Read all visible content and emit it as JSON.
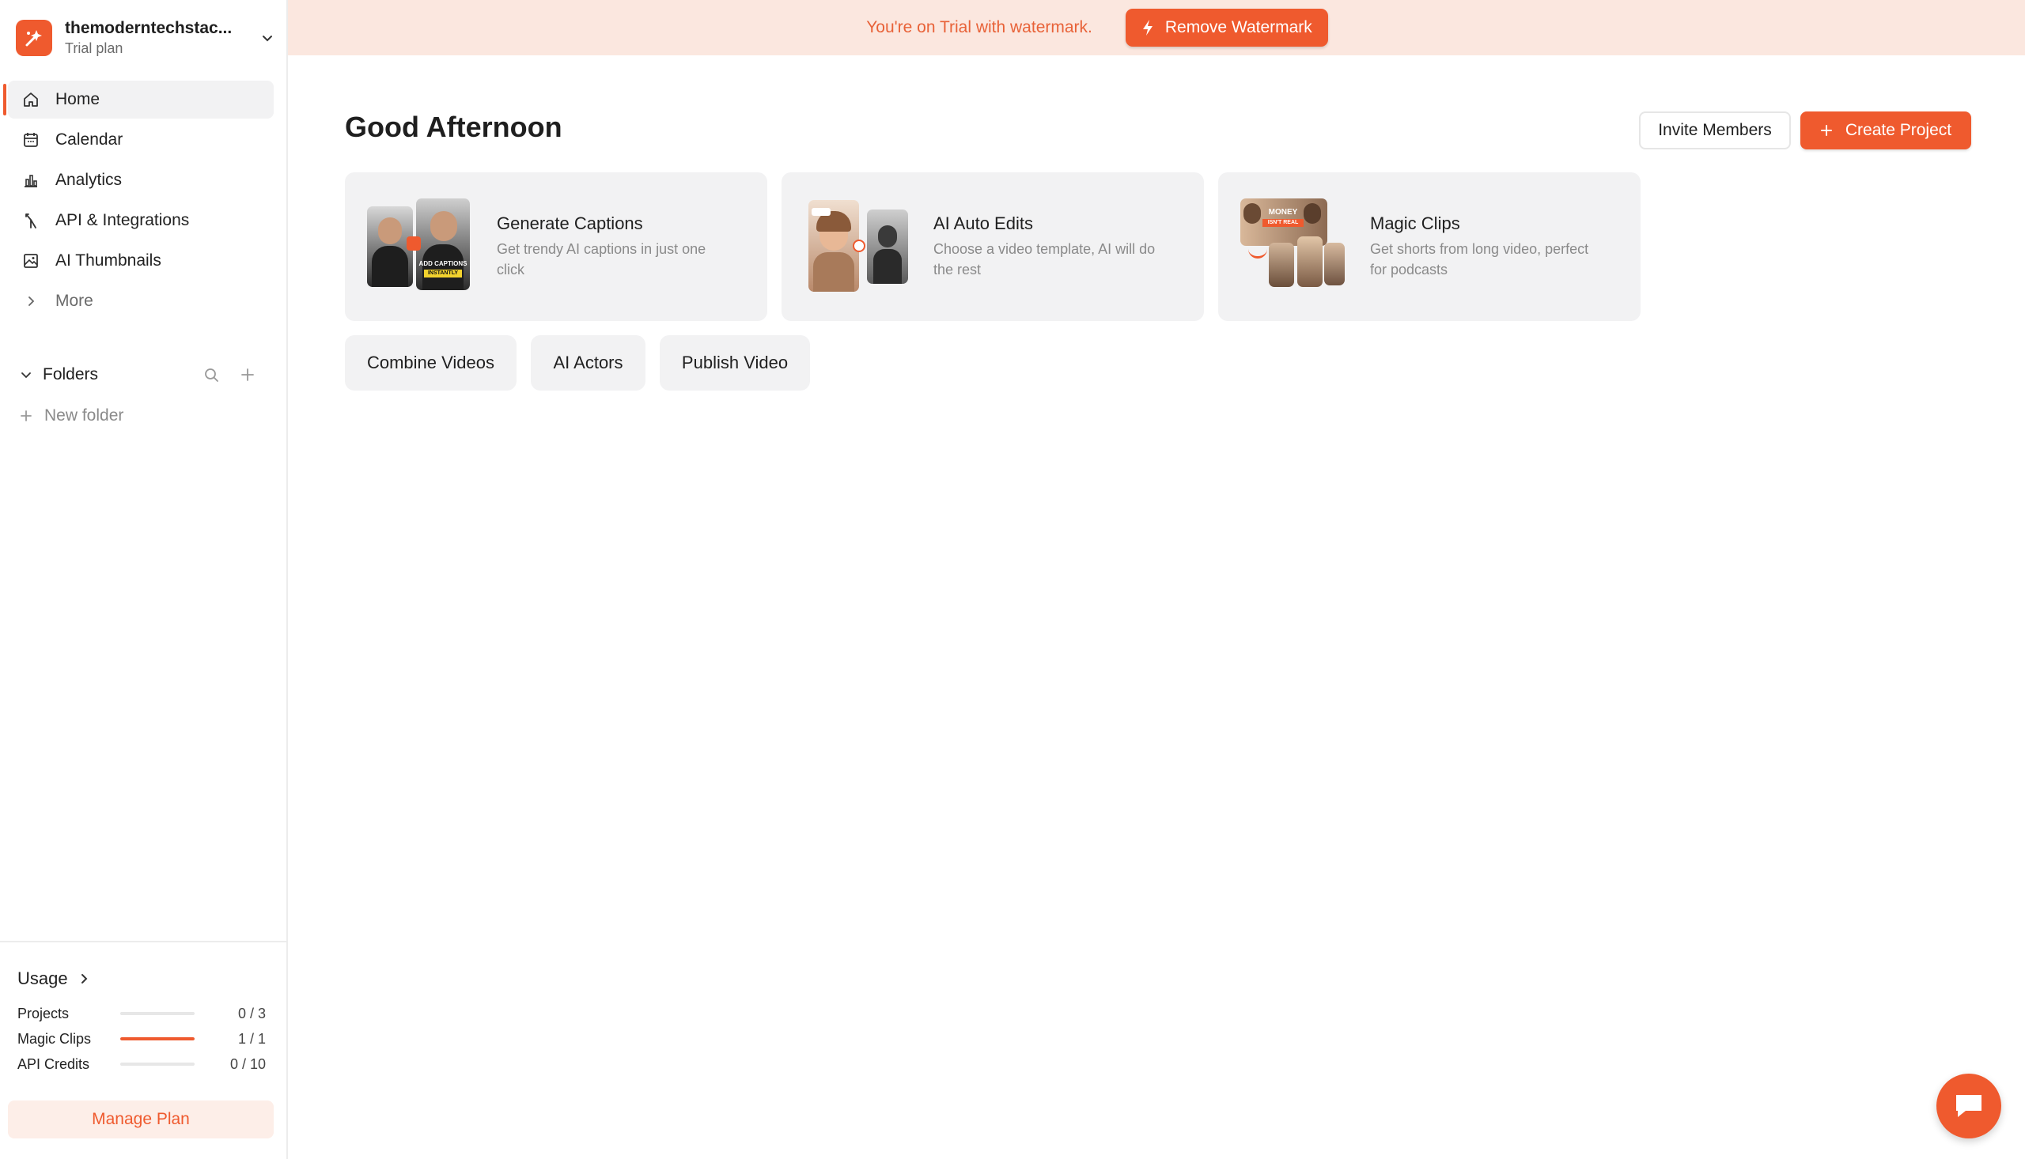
{
  "workspace": {
    "name": "themoderntechstac...",
    "plan": "Trial plan"
  },
  "nav": {
    "items": [
      {
        "label": "Home",
        "icon": "home-icon"
      },
      {
        "label": "Calendar",
        "icon": "calendar-icon"
      },
      {
        "label": "Analytics",
        "icon": "bar-chart-icon"
      },
      {
        "label": "API & Integrations",
        "icon": "merge-arrow-icon"
      },
      {
        "label": "AI Thumbnails",
        "icon": "image-icon"
      },
      {
        "label": "More",
        "icon": "chevron-right-icon"
      }
    ],
    "active": "Home"
  },
  "folders": {
    "title": "Folders",
    "new_folder": "New folder"
  },
  "usage": {
    "title": "Usage",
    "rows": [
      {
        "label": "Projects",
        "value": "0 / 3",
        "fraction": 0
      },
      {
        "label": "Magic Clips",
        "value": "1 / 1",
        "fraction": 1
      },
      {
        "label": "API Credits",
        "value": "0 / 10",
        "fraction": 0
      }
    ],
    "manage_plan": "Manage Plan"
  },
  "banner": {
    "text": "You're on Trial with watermark.",
    "button": "Remove Watermark"
  },
  "main": {
    "greeting": "Good Afternoon",
    "invite_button": "Invite Members",
    "create_button": "Create Project",
    "cards": [
      {
        "title": "Generate Captions",
        "desc": "Get trendy AI captions in just one click"
      },
      {
        "title": "AI Auto Edits",
        "desc": "Choose a video template, AI will do the rest"
      },
      {
        "title": "Magic Clips",
        "desc": "Get shorts from long video, perfect for podcasts"
      }
    ],
    "chips": [
      "Combine Videos",
      "AI Actors",
      "Publish Video"
    ]
  },
  "thumb_text": {
    "add_captions": "ADD CAPTIONS",
    "instantly": "INSTANTLY",
    "money": "MONEY",
    "isnt_real": "ISN'T REAL"
  },
  "colors": {
    "accent": "#ef5a2e",
    "banner_bg": "#fbe7df",
    "card_bg": "#f2f2f3"
  }
}
